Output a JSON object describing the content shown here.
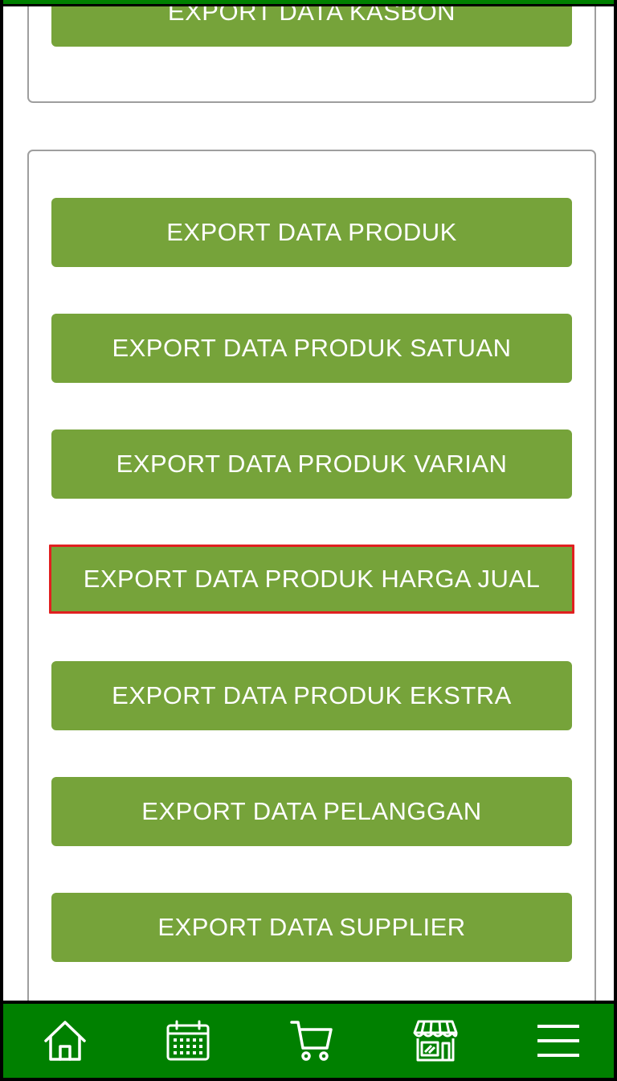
{
  "buttons": {
    "kasbon": "EXPORT DATA KASBON",
    "produk": "EXPORT DATA PRODUK",
    "produk_satuan": "EXPORT DATA PRODUK SATUAN",
    "produk_varian": "EXPORT DATA PRODUK VARIAN",
    "produk_harga_jual": "EXPORT DATA PRODUK HARGA JUAL",
    "produk_ekstra": "EXPORT DATA PRODUK EKSTRA",
    "pelanggan": "EXPORT DATA PELANGGAN",
    "supplier": "EXPORT DATA SUPPLIER"
  },
  "bottom_nav": {
    "items": [
      {
        "icon": "home-icon"
      },
      {
        "icon": "calendar-icon"
      },
      {
        "icon": "cart-icon"
      },
      {
        "icon": "store-icon"
      },
      {
        "icon": "menu-icon"
      }
    ]
  },
  "colors": {
    "button_bg": "#76a33a",
    "nav_bg": "#008000",
    "highlight_border": "#e02020",
    "card_border": "#9e9e9e"
  }
}
